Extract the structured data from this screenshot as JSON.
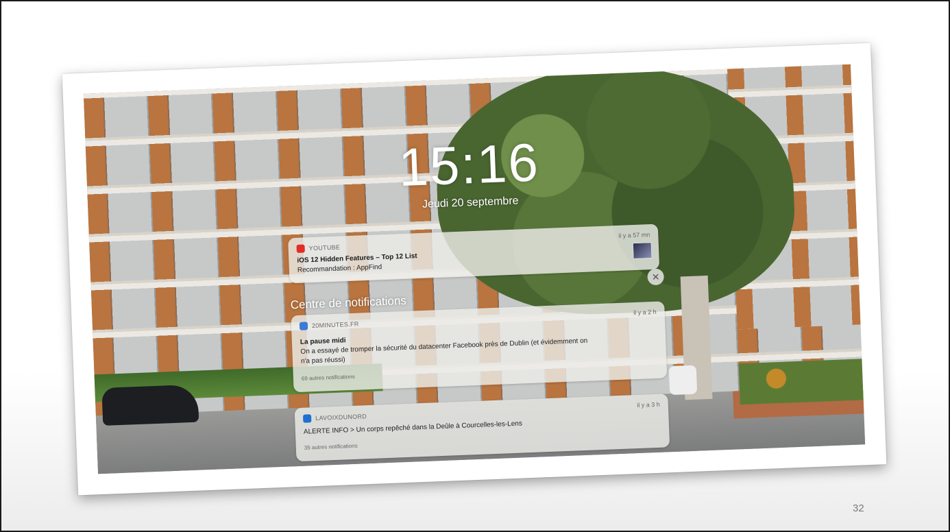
{
  "lock_screen": {
    "time": "15:16",
    "date": "Jeudi 20 septembre",
    "notification_center_title": "Centre de notifications"
  },
  "notifications": [
    {
      "app": "YOUTUBE",
      "app_icon": "youtube-icon",
      "app_color": "#e52d27",
      "time": "il y a 57 mn",
      "title": "iOS 12 Hidden Features – Top 12 List",
      "body": "Recommandation : AppFind",
      "has_thumbnail": true
    },
    {
      "app": "20MINUTES.FR",
      "app_icon": "20minutes-icon",
      "app_color": "#3a7bd5",
      "time": "il y a 2 h",
      "title": "La pause midi",
      "body_line1": "On a essayé de tromper la sécurité du datacenter Facebook près de Dublin (et évidemment on",
      "body_line2": "n'a pas réussi)",
      "more": "69 autres notifications"
    },
    {
      "app": "LAVOIXDUNORD",
      "app_icon": "lavoixdunord-icon",
      "app_color": "#1f6fd1",
      "time": "il y a 3 h",
      "body": "ALERTE INFO > Un corps repêché dans la Deûle à Courcelles-les-Lens",
      "more": "35 autres notifications"
    }
  ],
  "slide": {
    "page_number": "32"
  }
}
